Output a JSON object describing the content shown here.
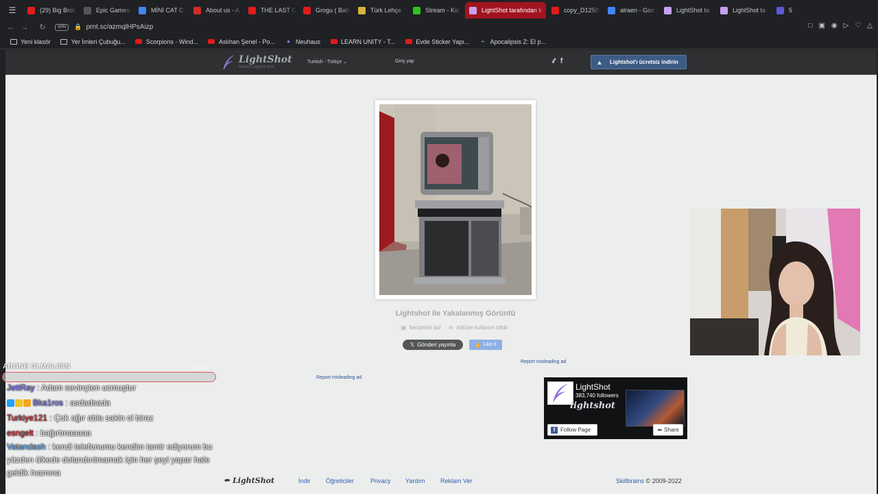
{
  "browser": {
    "tabs": [
      {
        "label": "(29) Big Brot",
        "favicon": "youtube-icon",
        "color": "#e21b1b",
        "width": 80,
        "active": false
      },
      {
        "label": "Epic Games",
        "favicon": "epic-games-icon",
        "color": "#555",
        "width": 78,
        "active": false
      },
      {
        "label": "MİNİ CAT C",
        "favicon": "google-icon",
        "color": "#4285f4",
        "width": 78,
        "active": false
      },
      {
        "label": "About us - A",
        "favicon": "red-logo-icon",
        "color": "#d12a2a",
        "width": 78,
        "active": false
      },
      {
        "label": "THE LAST C",
        "favicon": "youtube-icon",
        "color": "#e21b1b",
        "width": 78,
        "active": false
      },
      {
        "label": "Grogu ( Bab",
        "favicon": "youtube-icon",
        "color": "#e21b1b",
        "width": 78,
        "active": false
      },
      {
        "label": "Türk Lehçe",
        "favicon": "yellow-page-icon",
        "color": "#d6b43c",
        "width": 78,
        "active": false
      },
      {
        "label": "Stream - Kic",
        "favicon": "kick-icon",
        "color": "#2ec41f",
        "width": 80,
        "active": false
      },
      {
        "label": "LightShot tarafından k",
        "favicon": "lightshot-icon",
        "color": "#c8a0f0",
        "width": 118,
        "active": true
      },
      {
        "label": "copy_D1250",
        "favicon": "youtube-icon",
        "color": "#e21b1b",
        "width": 80,
        "active": false
      },
      {
        "label": "alraen - Goo",
        "favicon": "google-icon",
        "color": "#4285f4",
        "width": 80,
        "active": false
      },
      {
        "label": "LightShot ta",
        "favicon": "lightshot-icon",
        "color": "#c8a0f0",
        "width": 80,
        "active": false
      },
      {
        "label": "LightShot ta",
        "favicon": "lightshot-icon",
        "color": "#c8a0f0",
        "width": 80,
        "active": false
      },
      {
        "label": "5",
        "favicon": "h-icon",
        "color": "#5b5bd6",
        "width": 60,
        "active": false
      }
    ],
    "tab_menu_icon": "tab-search-icon",
    "vpn_label": "VPN",
    "url": "prnt.sc/azmqlHPsAizp",
    "bookmarks": [
      {
        "label": "Yeni klasör",
        "icon": "folder"
      },
      {
        "label": "Yer İmleri Çubuğu...",
        "icon": "folder"
      },
      {
        "label": "Scorpions - Wind...",
        "icon": "yt"
      },
      {
        "label": "Aslıhan Şenel - Po...",
        "icon": "yt"
      },
      {
        "label": "Neuhaus",
        "icon": "neuhaus"
      },
      {
        "label": "LEARN UNITY - T...",
        "icon": "yt"
      },
      {
        "label": "Evde Sticker Yapı...",
        "icon": "yt"
      },
      {
        "label": "Apocalipsis Z: El p...",
        "icon": "apoc"
      }
    ]
  },
  "header": {
    "logo_name": "LightShot",
    "logo_subtitle": "screen capture tool",
    "language": "Turkish - Türkçe",
    "login": "Giriş yap",
    "social": [
      "twitter-icon",
      "facebook-icon"
    ],
    "download_button": "Lightshot'ı ücretsiz indirin"
  },
  "screenshot": {
    "caption": "Lightshot ile Yakalanmış Görüntü",
    "action_similar": "benzerini bul",
    "action_report": "kötüye kullanım bildir",
    "tweet_button": "Gönderi yayınla",
    "like_button": "Like 0"
  },
  "ads": {
    "report_misleading_right": "Report misleading ad",
    "report_misleading_left": "Report misleading ad"
  },
  "facebook_widget": {
    "page_name": "LightShot",
    "followers": "383,740 followers",
    "wordmark": "lightshot",
    "follow_button": "Follow Page",
    "share_button": "Share"
  },
  "footer": {
    "logo": "LightShot",
    "links": [
      "İndir",
      "Öğreticiler",
      "Privacy",
      "Yardım",
      "Reklam Ver"
    ],
    "company": "Skillbrains",
    "copyright": "© 2009-2022"
  },
  "stream_chat": {
    "goal_title": "ABONE OLMALISIN",
    "goal_count": "0 / 10",
    "goal_progress": 0.0,
    "messages": [
      {
        "user": "JettRay",
        "user_color": "#7c7cff",
        "text": "Adam sevinçten ucmuştur",
        "badges": []
      },
      {
        "user": "Bka1ros",
        "user_color": "#7c7cff",
        "text": "asdadsada",
        "badges": [
          "#1fa1ff",
          "#f0c419",
          "#f5a623"
        ]
      },
      {
        "user": "Turkiye121",
        "user_color": "#d4262d",
        "text": "Çok ağır abla sakin ol biraz",
        "badges": []
      },
      {
        "user": "esngelt",
        "user_color": "#d4262d",
        "text": "bağırtmaaaaa",
        "badges": []
      },
      {
        "user": "Vatandash",
        "user_color": "#6ab4ff",
        "text": "kendi telefonumu kendim tamir ediyorum bu yüzden ülkede dolandırılmamak için her şeyi yapar hale geldik hıamına",
        "badges": []
      }
    ]
  }
}
